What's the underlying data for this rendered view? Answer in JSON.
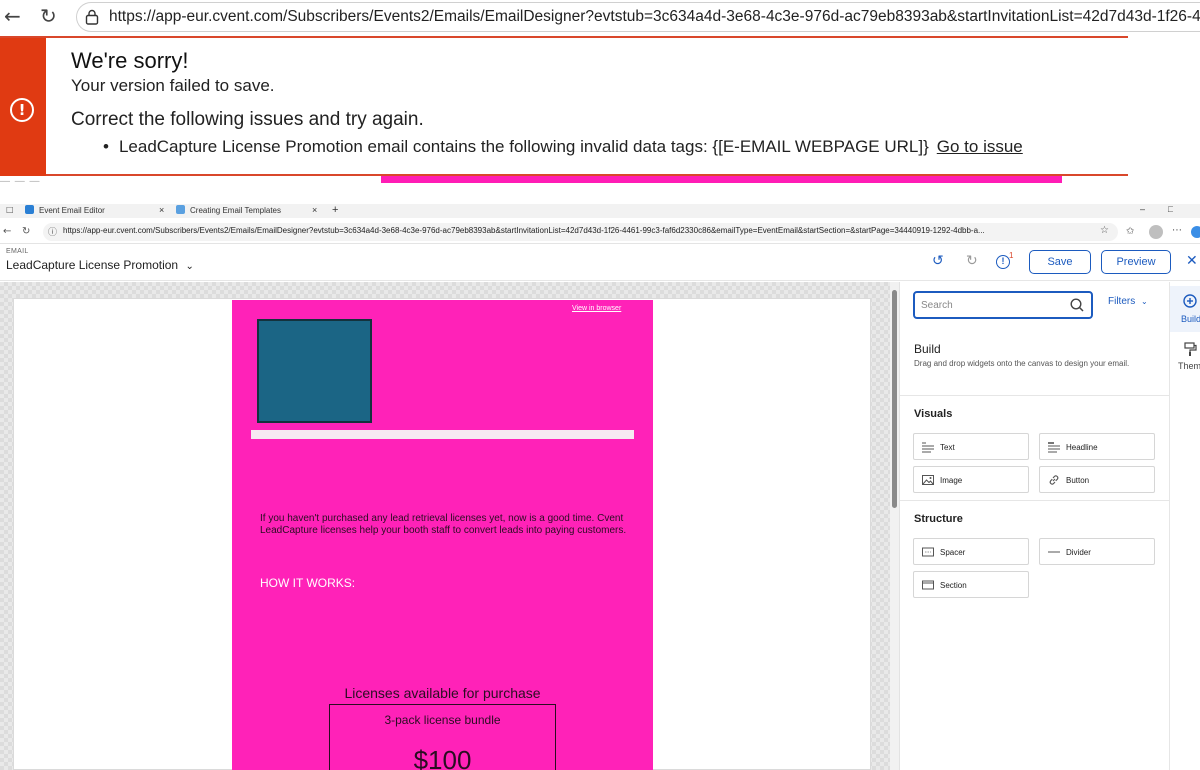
{
  "browser_top": {
    "url": "https://app-eur.cvent.com/Subscribers/Events2/Emails/EmailDesigner?evtstub=3c634a4d-3e68-4c3e-976d-ac79eb8393ab&startInvitationList=42d7d43d-1f26-4"
  },
  "error": {
    "title": "We're sorry!",
    "subtitle": "Your version failed to save.",
    "instruction": "Correct the following issues and try again.",
    "issue_text": "LeadCapture License Promotion email contains the following invalid data tags: {[E-EMAIL WEBPAGE URL]}",
    "issue_link": "Go to issue",
    "accent_color": "#e03a12"
  },
  "browser_inner": {
    "tabs": [
      {
        "label": "Event Email Editor",
        "close": "×"
      },
      {
        "label": "Creating Email Templates",
        "close": "×"
      }
    ],
    "new_tab": "+",
    "url": "https://app-eur.cvent.com/Subscribers/Events2/Emails/EmailDesigner?evtstub=3c634a4d-3e68-4c3e-976d-ac79eb8393ab&startInvitationList=42d7d43d-1f26-4461-99c3-faf6d2330c86&emailType=EventEmail&startSection=&startPage=34440919-1292-4dbb-a..."
  },
  "header": {
    "eyebrow": "EMAIL",
    "email_name": "LeadCapture License Promotion",
    "issues_count": "1",
    "save_label": "Save",
    "preview_label": "Preview",
    "brand_color": "#1c5bbf"
  },
  "email": {
    "view_in_browser": "View in browser",
    "body_copy": "If you haven't purchased any lead retrieval licenses yet, now is a good time. Cvent LeadCapture licenses help your booth staff to convert leads into paying customers.",
    "how_it_works": "HOW IT WORKS:",
    "licenses_heading": "Licenses available for purchase",
    "bundle_label": "3-pack license bundle",
    "bundle_price": "$100",
    "background_color": "#ff22b8"
  },
  "panel": {
    "search_placeholder": "Search",
    "filters_label": "Filters",
    "build_title": "Build",
    "build_desc": "Drag and drop widgets onto the canvas to design your email.",
    "visuals_heading": "Visuals",
    "visuals": [
      {
        "label": "Text",
        "icon": "text-lines-icon"
      },
      {
        "label": "Headline",
        "icon": "headline-icon"
      },
      {
        "label": "Image",
        "icon": "image-icon"
      },
      {
        "label": "Button",
        "icon": "link-icon"
      }
    ],
    "structure_heading": "Structure",
    "structure": [
      {
        "label": "Spacer",
        "icon": "spacer-icon"
      },
      {
        "label": "Divider",
        "icon": "divider-icon"
      },
      {
        "label": "Section",
        "icon": "section-icon"
      }
    ]
  },
  "side_tabs": {
    "build": "Build",
    "theme": "Theme"
  }
}
